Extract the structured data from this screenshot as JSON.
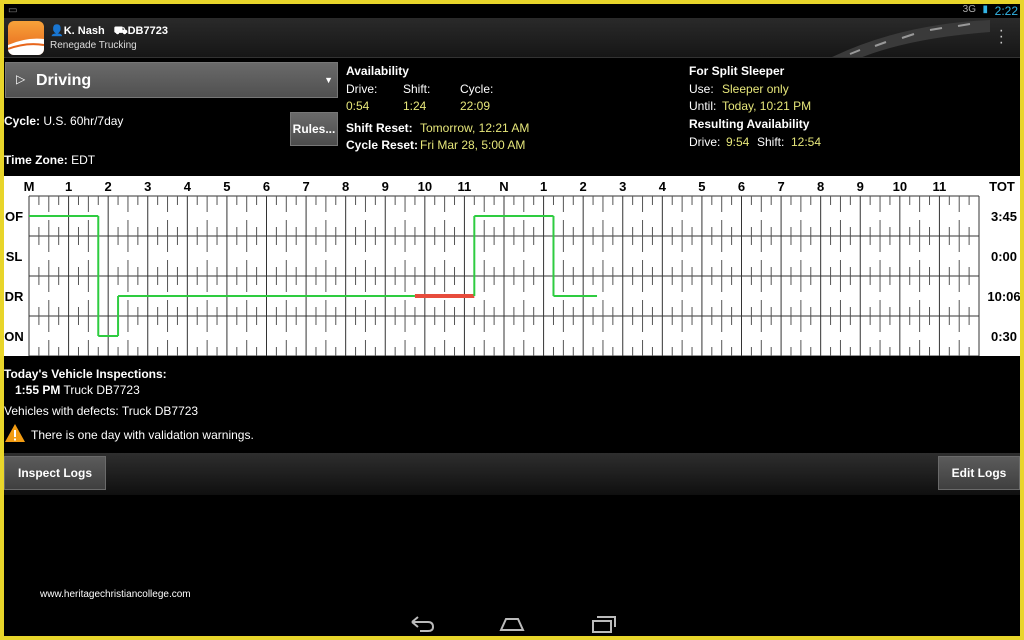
{
  "status_bar": {
    "time": "2:22",
    "signal_label": "3G"
  },
  "header": {
    "driver": "K. Nash",
    "vehicle": "DB7723",
    "company": "Renegade Trucking"
  },
  "duty_status": {
    "current": "Driving"
  },
  "cycle": {
    "label": "Cycle:",
    "value": "U.S. 60hr/7day"
  },
  "time_zone": {
    "label": "Time Zone:",
    "value": "EDT"
  },
  "rules_button": "Rules...",
  "availability": {
    "title": "Availability",
    "drive_label": "Drive:",
    "drive_value": "0:54",
    "shift_label": "Shift:",
    "shift_value": "1:24",
    "cycle_label": "Cycle:",
    "cycle_value": "22:09",
    "shift_reset_label": "Shift Reset:",
    "shift_reset_value": "Tomorrow, 12:21 AM",
    "cycle_reset_label": "Cycle Reset:",
    "cycle_reset_value": "Fri Mar 28, 5:00 AM"
  },
  "split_sleeper": {
    "title": "For Split Sleeper",
    "use_label": "Use:",
    "use_value": "Sleeper only",
    "until_label": "Until:",
    "until_value": "Today, 10:21 PM",
    "resulting_title": "Resulting Availability",
    "drive_label": "Drive:",
    "drive_value": "9:54",
    "shift_label": "Shift:",
    "shift_value": "12:54"
  },
  "log_grid": {
    "hour_labels": [
      "M",
      "1",
      "2",
      "3",
      "4",
      "5",
      "6",
      "7",
      "8",
      "9",
      "10",
      "11",
      "N",
      "1",
      "2",
      "3",
      "4",
      "5",
      "6",
      "7",
      "8",
      "9",
      "10",
      "11"
    ],
    "total_header": "TOT",
    "rows": [
      {
        "label": "OF",
        "total": "3:45"
      },
      {
        "label": "SL",
        "total": "0:00"
      },
      {
        "label": "DR",
        "total": "10:06"
      },
      {
        "label": "ON",
        "total": "0:30"
      }
    ],
    "line_color": "#2ecc40",
    "violation_color": "#e74c3c",
    "segments": [
      {
        "row": 0,
        "start": 0.0,
        "end": 1.75
      },
      {
        "row": 3,
        "start": 1.75,
        "end": 2.25
      },
      {
        "row": 2,
        "start": 2.25,
        "end": 9.75
      },
      {
        "row": 2,
        "start": 9.75,
        "end": 11.25,
        "violation": true
      },
      {
        "row": 0,
        "start": 11.25,
        "end": 13.25
      },
      {
        "row": 2,
        "start": 13.25,
        "end": 14.35
      }
    ]
  },
  "inspections": {
    "title": "Today's Vehicle Inspections:",
    "entries": [
      {
        "time": "1:55 PM",
        "vehicle": "Truck DB7723"
      }
    ],
    "defects": "Vehicles with defects: Truck DB7723",
    "warning": "There is one day with validation warnings."
  },
  "buttons": {
    "inspect": "Inspect Logs",
    "edit": "Edit Logs"
  },
  "watermark": "www.heritagechristiancollege.com"
}
